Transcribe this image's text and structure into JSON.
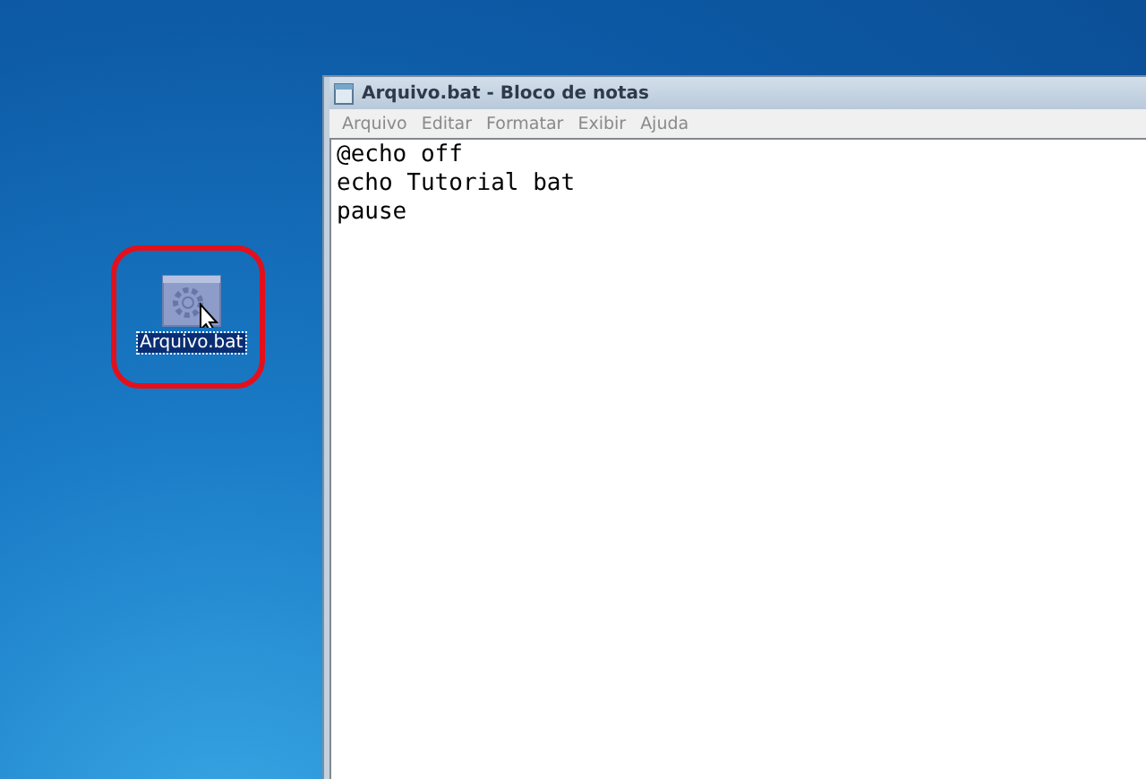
{
  "desktop_icon": {
    "label": "Arquivo.bat",
    "selected": true,
    "highlighted": true
  },
  "window": {
    "title": "Arquivo.bat - Bloco de notas"
  },
  "menu": [
    "Arquivo",
    "Editar",
    "Formatar",
    "Exibir",
    "Ajuda"
  ],
  "editor": {
    "lines": [
      "@echo off",
      "echo Tutorial bat",
      "pause"
    ]
  }
}
